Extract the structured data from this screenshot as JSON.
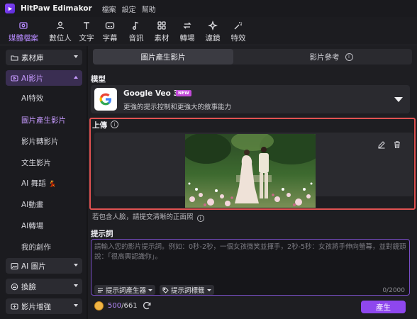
{
  "app": {
    "title": "HitPaw Edimakor",
    "menu": [
      "檔案",
      "設定",
      "幫助"
    ]
  },
  "toolbar": {
    "items": [
      {
        "label": "媒體檔案",
        "icon": "media-files-icon",
        "active": true
      },
      {
        "label": "數位人",
        "icon": "digital-human-icon",
        "active": false
      },
      {
        "label": "文字",
        "icon": "text-icon",
        "active": false
      },
      {
        "label": "字幕",
        "icon": "subtitle-icon",
        "active": false
      },
      {
        "label": "音訊",
        "icon": "audio-icon",
        "active": false
      },
      {
        "label": "素材",
        "icon": "assets-icon",
        "active": false
      },
      {
        "label": "轉場",
        "icon": "transition-icon",
        "active": false
      },
      {
        "label": "濾鏡",
        "icon": "filter-icon",
        "active": false
      },
      {
        "label": "特效",
        "icon": "effects-icon",
        "active": false
      }
    ]
  },
  "sidebar": {
    "categories": [
      {
        "label": "素材庫",
        "icon": "folder-icon",
        "open": false
      },
      {
        "label": "AI影片",
        "icon": "ai-video-icon",
        "open": true
      },
      {
        "label": "AI 圖片",
        "icon": "ai-image-icon",
        "open": false
      },
      {
        "label": "換臉",
        "icon": "face-swap-icon",
        "open": false
      },
      {
        "label": "影片增強",
        "icon": "video-enhance-icon",
        "open": false
      }
    ],
    "sub_items": [
      {
        "label": "AI特效",
        "active": false
      },
      {
        "label": "圖片產生影片",
        "active": true
      },
      {
        "label": "影片轉影片",
        "active": false
      },
      {
        "label": "文生影片",
        "active": false
      },
      {
        "label": "AI 舞蹈",
        "active": false,
        "emoji": "💃"
      },
      {
        "label": "AI動畫",
        "active": false
      },
      {
        "label": "AI轉場",
        "active": false
      },
      {
        "label": "我的創作",
        "active": false
      }
    ]
  },
  "main": {
    "tabs": [
      {
        "label": "圖片產生影片",
        "active": true
      },
      {
        "label": "影片參考",
        "active": false,
        "info": "i"
      }
    ],
    "model_section": {
      "label": "模型",
      "name": "Google Veo 3.1",
      "badge": "NEW",
      "description": "更強的提示控制和更強大的敘事能力"
    },
    "upload_section": {
      "label": "上傳",
      "info": "i",
      "hint": "若包含人臉，請提交清晰的正面照",
      "hint_info": "i"
    },
    "prompt_section": {
      "label": "提示詞",
      "placeholder": "請輸入您的影片提示詞。例如：0秒-2秒，一個女孩微笑並揮手，2秒-5秒：女孩將手伸向螢幕，並對鏡頭說：「很高興認識你」。",
      "generator_button": "提示詞產生器",
      "tag_button": "提示詞標籤",
      "counter": "0/2000"
    },
    "footer": {
      "credits_current": "500",
      "credits_total": "/661",
      "generate_button": "產生"
    }
  },
  "colors": {
    "accent": "#8e47ee",
    "accent_text": "#b78bff",
    "highlight_border": "#e15252",
    "background": "#1b1b1f"
  }
}
